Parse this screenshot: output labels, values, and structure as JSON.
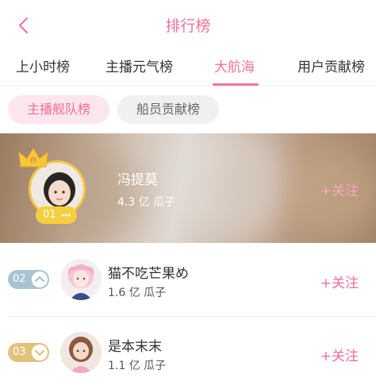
{
  "header": {
    "title": "排行榜"
  },
  "tabs": [
    {
      "label": "上小时榜"
    },
    {
      "label": "主播元气榜"
    },
    {
      "label": "大航海"
    },
    {
      "label": "用户贡献榜"
    }
  ],
  "subtabs": [
    {
      "label": "主播舰队榜"
    },
    {
      "label": "船员贡献榜"
    }
  ],
  "top_entry": {
    "rank": "01",
    "name": "冯提莫",
    "score": "4.3 亿 瓜子",
    "follow": "+关注"
  },
  "entries": [
    {
      "rank": "02",
      "name": "猫不吃芒果め",
      "score": "1.6 亿 瓜子",
      "follow": "+关注"
    },
    {
      "rank": "03",
      "name": "是本末末",
      "score": "1.1 亿 瓜子",
      "follow": "+关注"
    }
  ],
  "colors": {
    "accent": "#f0739a",
    "gold": "#f6cf3f",
    "silver": "#a9c3d3",
    "bronze": "#e2c27a"
  },
  "icons": {
    "back": "chevron-left-icon",
    "crown": "crown-icon",
    "rank_up": "chevron-up-icon",
    "rank_down": "chevron-down-icon"
  }
}
